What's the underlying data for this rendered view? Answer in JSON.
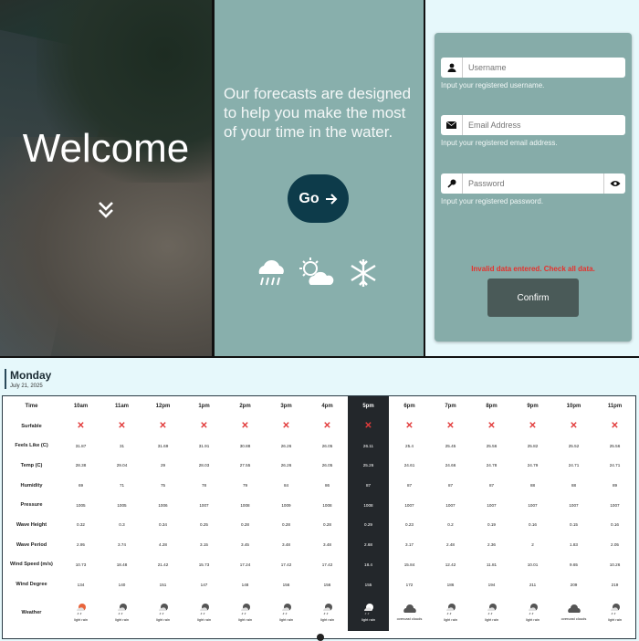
{
  "hero": {
    "welcome": "Welcome",
    "tagline": "Our forecasts are designed to help you make the most of your time in the water.",
    "go_label": "Go",
    "icons": [
      "down-chevron-icon",
      "rain-cloud-icon",
      "sun-cloud-icon",
      "snowflake-icon"
    ]
  },
  "form": {
    "username_placeholder": "Username",
    "username_hint": "Input your registered username.",
    "email_placeholder": "Email Address",
    "email_hint": "Input your registered email address.",
    "password_placeholder": "Password",
    "password_hint": "Input your registered password.",
    "error": "Invalid data entered. Check all data.",
    "confirm_label": "Confirm",
    "colors": {
      "card": "#86aca9",
      "error": "#e5322d",
      "button": "#4a5a58"
    }
  },
  "forecast": {
    "day": "Monday",
    "date": "July 21, 2025",
    "highlight_index": 7,
    "columns": [
      "Time",
      "10am",
      "11am",
      "12pm",
      "1pm",
      "2pm",
      "3pm",
      "4pm",
      "5pm",
      "6pm",
      "7pm",
      "8pm",
      "9pm",
      "10pm",
      "11pm"
    ],
    "rows": [
      {
        "label": "Surfable",
        "type": "icon",
        "values": [
          "x",
          "x",
          "x",
          "x",
          "x",
          "x",
          "x",
          "x",
          "x",
          "x",
          "x",
          "x",
          "x",
          "x"
        ]
      },
      {
        "label": "Feels Like (C)",
        "values": [
          "31.87",
          "31",
          "31.69",
          "31.91",
          "30.88",
          "26.26",
          "26.05",
          "26.11",
          "25.4",
          "25.45",
          "25.56",
          "25.82",
          "25.52",
          "25.56"
        ]
      },
      {
        "label": "Temp (C)",
        "values": [
          "28.38",
          "29.04",
          "29",
          "28.03",
          "27.55",
          "26.26",
          "26.05",
          "25.26",
          "24.61",
          "24.66",
          "24.78",
          "24.79",
          "24.71",
          "24.71"
        ]
      },
      {
        "label": "Humidity",
        "values": [
          "69",
          "71",
          "75",
          "78",
          "79",
          "84",
          "86",
          "87",
          "87",
          "87",
          "87",
          "88",
          "88",
          "89"
        ]
      },
      {
        "label": "Pressure",
        "values": [
          "1005",
          "1005",
          "1006",
          "1007",
          "1008",
          "1009",
          "1008",
          "1008",
          "1007",
          "1007",
          "1007",
          "1007",
          "1007",
          "1007"
        ]
      },
      {
        "label": "Wave Height",
        "values": [
          "0.32",
          "0.3",
          "0.34",
          "0.25",
          "0.28",
          "0.28",
          "0.28",
          "0.29",
          "0.23",
          "0.2",
          "0.19",
          "0.16",
          "0.15",
          "0.16"
        ]
      },
      {
        "label": "Wave Period",
        "values": [
          "2.95",
          "3.74",
          "4.28",
          "3.15",
          "3.45",
          "3.48",
          "3.48",
          "2.68",
          "3.17",
          "2.48",
          "2.36",
          "2",
          "1.83",
          "2.05"
        ]
      },
      {
        "label": "Wind Speed (m/s)",
        "values": [
          "10.73",
          "18.48",
          "21.42",
          "15.73",
          "17.24",
          "17.42",
          "17.42",
          "18.4",
          "15.84",
          "12.42",
          "11.81",
          "10.01",
          "9.65",
          "10.26"
        ]
      },
      {
        "label": "Wind Degree",
        "values": [
          "134",
          "140",
          "151",
          "147",
          "148",
          "156",
          "156",
          "155",
          "172",
          "186",
          "194",
          "211",
          "209",
          "219"
        ]
      }
    ],
    "weather_label": "Weather",
    "weather": [
      "light rain",
      "light rain",
      "light rain",
      "light rain",
      "light rain",
      "light rain",
      "light rain",
      "light rain",
      "overcast clouds",
      "light rain",
      "light rain",
      "light rain",
      "overcast clouds",
      "light rain"
    ],
    "surfable_no_color": "#e23b3b"
  }
}
